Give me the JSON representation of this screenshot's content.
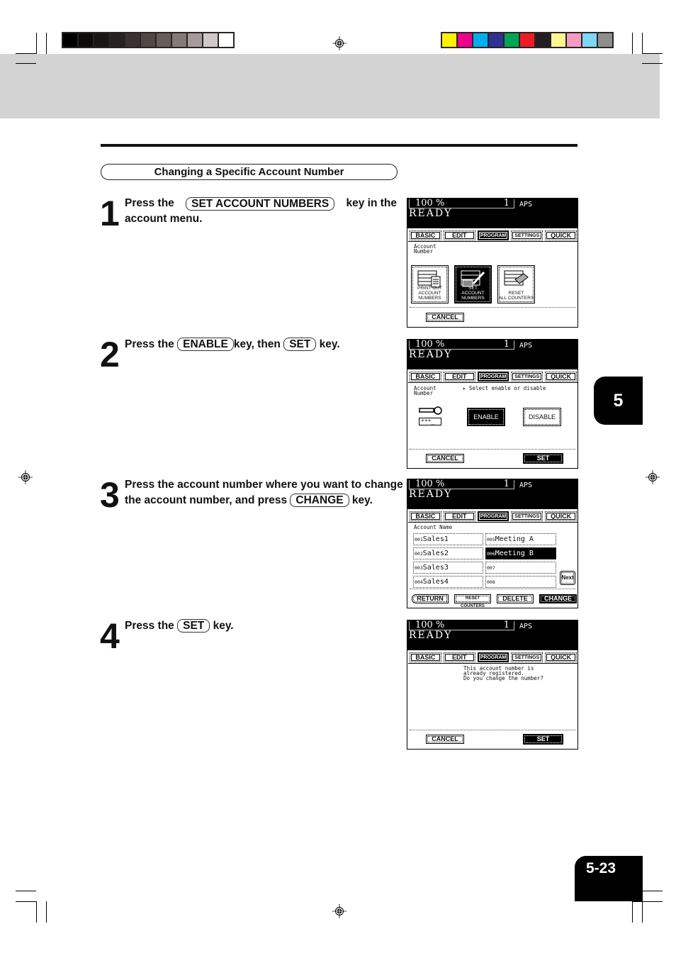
{
  "print_marks": {
    "gray_swatches": [
      "#000000",
      "#0d0b0a",
      "#181514",
      "#252220",
      "#3b3230",
      "#514845",
      "#675e5b",
      "#867a77",
      "#a69b98",
      "#d1c9c7",
      "#ffffff"
    ],
    "color_swatches": [
      "#fff200",
      "#ec008c",
      "#00aeef",
      "#2e3192",
      "#00a651",
      "#ed1c24",
      "#231f20",
      "#fff68f",
      "#f49ac1",
      "#7fd6f7",
      "#8f8e8e"
    ]
  },
  "section": {
    "title": "Changing a Specific Account Number"
  },
  "steps": [
    {
      "number": "1",
      "pre": "Press the",
      "key": "SET ACCOUNT NUMBERS",
      "post": "key in the",
      "line2": "account menu."
    },
    {
      "number": "2",
      "pre": "Press the",
      "key": "ENABLE",
      "mid": "key, then",
      "key2": "SET",
      "post": "key."
    },
    {
      "number": "3",
      "line1": "Press the account number where you want to change",
      "pre": "the account number, and press",
      "key": "CHANGE",
      "post": "key."
    },
    {
      "number": "4",
      "pre": "Press the",
      "key": "SET",
      "post": "key."
    }
  ],
  "screen": {
    "zoom": "100  %",
    "copies": "1",
    "paper": "APS",
    "status": "READY",
    "tabs": [
      "BASIC",
      "EDIT",
      "PROGRAM",
      "SETTINGS",
      "QUICK"
    ],
    "active_tab": "PROGRAM",
    "cancel": "CANCEL",
    "set": "SET"
  },
  "screen1": {
    "label": "Account\nNumber",
    "buttons": [
      {
        "line1": "PRINT OUT",
        "line2": "ACCOUNT NUMBERS"
      },
      {
        "line1": "SET",
        "line2": "ACCOUNT NUMBERS"
      },
      {
        "line1": "RESET",
        "line2": "ALL COUNTERS"
      }
    ]
  },
  "screen2": {
    "label": "Account\nNumber",
    "prompt": "▸ Select enable or disable",
    "key_field": "***_",
    "enable": "ENABLE",
    "disable": "DISABLE"
  },
  "screen3": {
    "label": "Account Name",
    "accounts": [
      {
        "no": "001",
        "name": "Sales1"
      },
      {
        "no": "002",
        "name": "Sales2"
      },
      {
        "no": "003",
        "name": "Sales3"
      },
      {
        "no": "004",
        "name": "Sales4"
      },
      {
        "no": "005",
        "name": "Meeting A"
      },
      {
        "no": "006",
        "name": "Meeting B",
        "selected": true
      },
      {
        "no": "007",
        "name": ""
      },
      {
        "no": "008",
        "name": ""
      }
    ],
    "next": "Next",
    "return": "RETURN",
    "reset_counters": "RESET COUNTERS",
    "delete": "DELETE",
    "change": "CHANGE"
  },
  "screen4": {
    "message": [
      "This account number is",
      "already registered.",
      "Do you change the number?"
    ]
  },
  "chapter_tab": "5",
  "page_number": "5-23"
}
